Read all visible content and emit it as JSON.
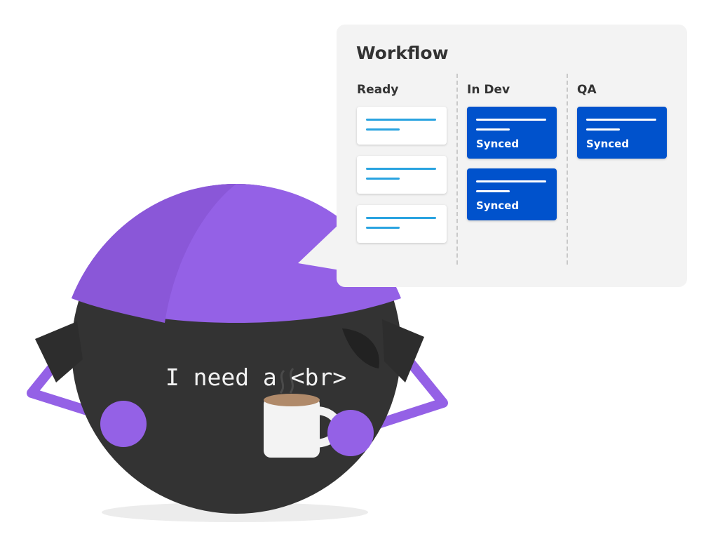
{
  "workflow": {
    "title": "Workflow",
    "columns": [
      {
        "title": "Ready",
        "cards": [
          {
            "label": ""
          },
          {
            "label": ""
          },
          {
            "label": ""
          }
        ]
      },
      {
        "title": "In Dev",
        "cards": [
          {
            "label": "Synced"
          },
          {
            "label": "Synced"
          }
        ]
      },
      {
        "title": "QA",
        "cards": [
          {
            "label": "Synced"
          }
        ]
      }
    ]
  },
  "character": {
    "speech": "I need a <br>"
  },
  "colors": {
    "purple": "#9461e6",
    "body": "#333333",
    "card_blue": "#0052cc",
    "line_blue": "#29a3e0"
  }
}
